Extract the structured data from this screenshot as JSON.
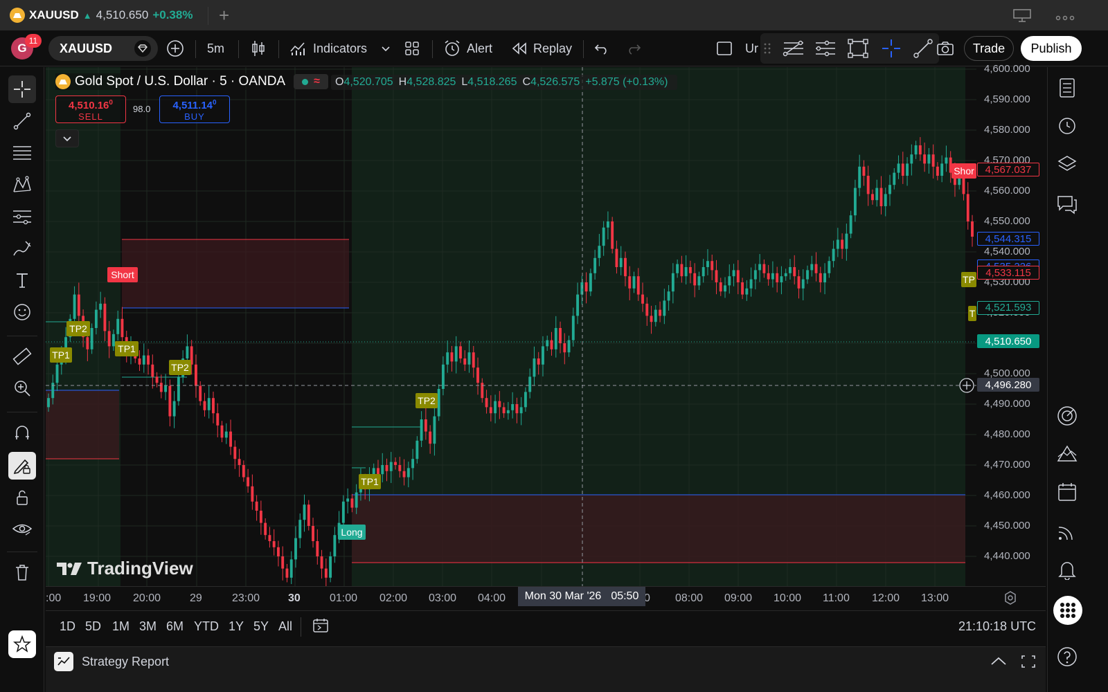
{
  "tab": {
    "symbol": "XAUUSD",
    "arrow": "▲",
    "price": "4,510.650",
    "change": "+0.38%"
  },
  "toolbar": {
    "avatar_letter": "G",
    "avatar_badge": "11",
    "symbol": "XAUUSD",
    "interval": "5m",
    "indicators": "Indicators",
    "alert": "Alert",
    "replay": "Replay",
    "unnamed": "Ur",
    "trade": "Trade",
    "publish": "Publish"
  },
  "legend": {
    "title": "Gold Spot / U.S. Dollar · 5 · OANDA",
    "o_key": "O",
    "o": "4,520.705",
    "h_key": "H",
    "h": "4,528.825",
    "l_key": "L",
    "l": "4,518.265",
    "c_key": "C",
    "c": "4,526.575",
    "chg": "+5.875 (+0.13%)"
  },
  "order": {
    "sell_price": "4,510.16",
    "sell_sup": "0",
    "sell_label": "SELL",
    "spread": "98.0",
    "buy_price": "4,511.14",
    "buy_sup": "0",
    "buy_label": "BUY"
  },
  "watermark": "TradingView",
  "price_axis": {
    "labels": [
      "4,600.000",
      "4,590.000",
      "4,580.000",
      "4,570.000",
      "4,560.000",
      "4,550.000",
      "4,540.000",
      "4,530.000",
      "4,520.000",
      "4,510.000",
      "4,500.000",
      "4,490.000",
      "4,480.000",
      "4,470.000",
      "4,460.000",
      "4,450.000",
      "4,440.000"
    ],
    "tags": [
      {
        "text": "4,567.037",
        "kind": "red-outline"
      },
      {
        "text": "4,544.315",
        "kind": "blue-outline"
      },
      {
        "text": "4,535.226",
        "kind": "blue-outline"
      },
      {
        "text": "4,533.115",
        "kind": "red-outline"
      },
      {
        "text": "4,521.593",
        "kind": "green-outline"
      },
      {
        "text": "4,510.650",
        "kind": "green-fill"
      },
      {
        "text": "4,496.280",
        "kind": "grey-fill"
      }
    ]
  },
  "time_axis": {
    "labels": [
      ":00",
      "19:00",
      "20:00",
      "29",
      "23:00",
      "30",
      "01:00",
      "02:00",
      "03:00",
      "04:00",
      "0",
      "08:00",
      "09:00",
      "10:00",
      "11:00",
      "12:00",
      "13:00"
    ],
    "crosshair_date": "Mon 30 Mar '26",
    "crosshair_time": "05:50"
  },
  "trade_labels": [
    {
      "text": "Short",
      "kind": "short"
    },
    {
      "text": "TP2",
      "kind": "tp"
    },
    {
      "text": "TP1",
      "kind": "tp"
    },
    {
      "text": "TP1",
      "kind": "tp"
    },
    {
      "text": "TP2",
      "kind": "tp"
    },
    {
      "text": "TP2",
      "kind": "tp"
    },
    {
      "text": "TP1",
      "kind": "tp"
    },
    {
      "text": "Long",
      "kind": "long"
    },
    {
      "text": "Shor",
      "kind": "short"
    },
    {
      "text": "TP",
      "kind": "tp"
    },
    {
      "text": "T",
      "kind": "tp"
    }
  ],
  "range": {
    "buttons": [
      "1D",
      "5D",
      "1M",
      "3M",
      "6M",
      "YTD",
      "1Y",
      "5Y",
      "All"
    ],
    "clock": "21:10:18 UTC"
  },
  "strategy_report": {
    "label": "Strategy Report"
  },
  "colors": {
    "up": "#22ab94",
    "down": "#f23645",
    "blue": "#2962ff",
    "tp": "#8a8a00",
    "accent": "#2962ff"
  },
  "chart_data": {
    "type": "candlestick",
    "symbol": "XAUUSD",
    "interval": "5",
    "ylim": [
      4432,
      4602
    ],
    "closes": [
      4492,
      4497,
      4503,
      4507,
      4512,
      4518,
      4526,
      4519,
      4512,
      4508,
      4515,
      4521,
      4523,
      4514,
      4509,
      4513,
      4518,
      4512,
      4507,
      4509,
      4505,
      4503,
      4506,
      4503,
      4499,
      4497,
      4494,
      4496,
      4486,
      4491,
      4499,
      4505,
      4509,
      4503,
      4496,
      4491,
      4488,
      4492,
      4487,
      4483,
      4479,
      4481,
      4476,
      4472,
      4470,
      4466,
      4463,
      4458,
      4455,
      4451,
      4447,
      4445,
      4443,
      4440,
      4436,
      4433,
      4439,
      4446,
      4452,
      4457,
      4450,
      4445,
      4440,
      4436,
      4433,
      4440,
      4447,
      4451,
      4458,
      4459,
      4456,
      4461,
      4465,
      4462,
      4466,
      4469,
      4467,
      4470,
      4468,
      4471,
      4470,
      4468,
      4466,
      4469,
      4472,
      4478,
      4485,
      4481,
      4477,
      4486,
      4495,
      4503,
      4507,
      4504,
      4509,
      4505,
      4503,
      4507,
      4502,
      4497,
      4492,
      4489,
      4487,
      4491,
      4489,
      4487,
      4488,
      4490,
      4487,
      4489,
      4494,
      4499,
      4505,
      4503,
      4509,
      4511,
      4508,
      4515,
      4510,
      4507,
      4511,
      4519,
      4526,
      4530,
      4527,
      4533,
      4538,
      4542,
      4548,
      4550,
      4541,
      4535,
      4538,
      4532,
      4528,
      4532,
      4526,
      4523,
      4519,
      4517,
      4521,
      4519,
      4524,
      4527,
      4533,
      4536,
      4532,
      4535,
      4533,
      4529,
      4532,
      4535,
      4537,
      4534,
      4530,
      4527,
      4529,
      4532,
      4534,
      4530,
      4526,
      4528,
      4531,
      4534,
      4536,
      4533,
      4531,
      4533,
      4530,
      4532,
      4533,
      4535,
      4532,
      4528,
      4531,
      4534,
      4536,
      4533,
      4530,
      4533,
      4537,
      4541,
      4544,
      4541,
      4546,
      4552,
      4561,
      4568,
      4565,
      4559,
      4557,
      4561,
      4555,
      4559,
      4562,
      4566,
      4569,
      4565,
      4569,
      4572,
      4575,
      4572,
      4569,
      4572,
      4568,
      4565,
      4569,
      4571,
      4566,
      4562,
      4566,
      4559,
      4550,
      4545
    ]
  }
}
